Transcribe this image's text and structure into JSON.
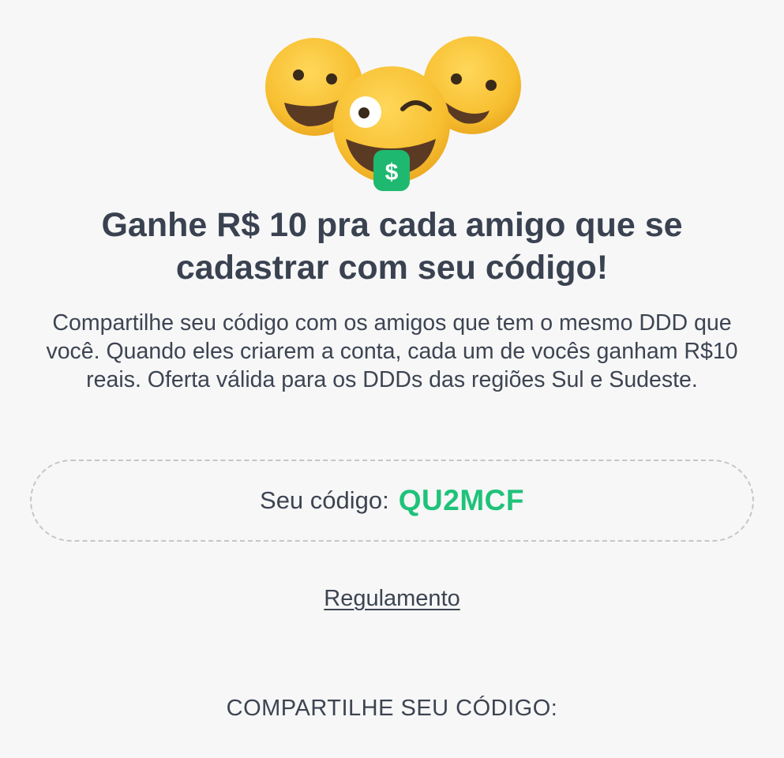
{
  "hero": {
    "icon": "smiling-faces-with-money-tongue",
    "money_symbol": "$"
  },
  "headline": "Ganhe R$ 10 pra cada amigo que se cadastrar com seu código!",
  "description": "Compartilhe seu código com os amigos que tem o mesmo DDD que você. Quando eles criarem a conta, cada um de vocês ganham R$10 reais. Oferta válida para os DDDs das regiões Sul e Sudeste.",
  "code": {
    "label": "Seu código:",
    "value": "QU2MCF"
  },
  "rules_link": "Regulamento",
  "share_title": "COMPARTILHE SEU CÓDIGO:",
  "colors": {
    "accent_green": "#1fc27a",
    "text_dark": "#3a4251",
    "emoji_yellow": "#f7c338",
    "background": "#f7f7f7"
  }
}
